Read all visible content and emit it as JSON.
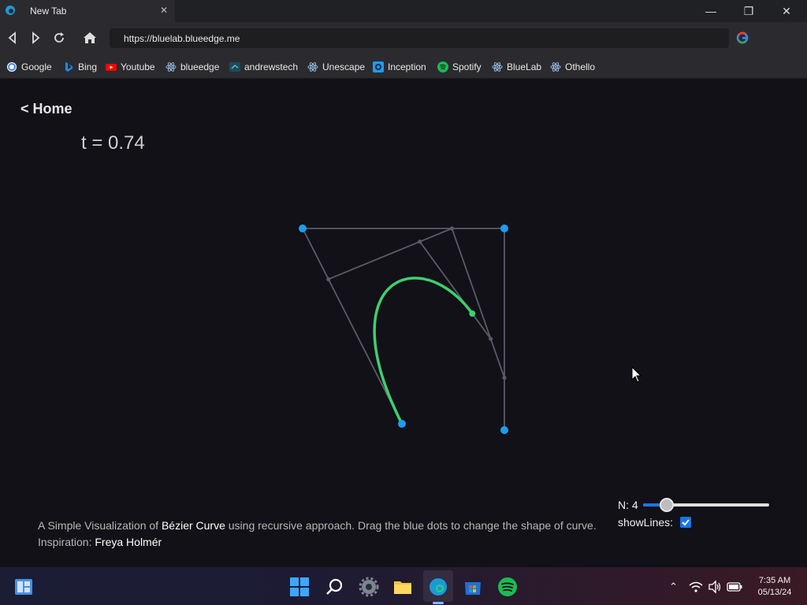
{
  "window": {
    "tab_title": "New Tab",
    "tab_close": "✕",
    "minimize": "—",
    "maximize": "❐",
    "close": "✕"
  },
  "toolbar": {
    "url": "https://bluelab.blueedge.me"
  },
  "bookmarks": [
    {
      "label": "Google",
      "icon": "google-icon",
      "color": "#4285f4"
    },
    {
      "label": "Bing",
      "icon": "bing-icon",
      "color": "#1a8cff"
    },
    {
      "label": "Youtube",
      "icon": "youtube-icon",
      "color": "#ff0000"
    },
    {
      "label": "blueedge",
      "icon": "react-icon",
      "color": "#8fb3d9"
    },
    {
      "label": "andrewstech",
      "icon": "andrewstech-icon",
      "color": "#2f6f8f"
    },
    {
      "label": "Unescape",
      "icon": "react-icon",
      "color": "#8fb3d9"
    },
    {
      "label": "Inception",
      "icon": "inception-icon",
      "color": "#1d9bf0"
    },
    {
      "label": "Spotify",
      "icon": "spotify-icon",
      "color": "#1db954"
    },
    {
      "label": "BlueLab",
      "icon": "react-icon",
      "color": "#8fb3d9"
    },
    {
      "label": "Othello",
      "icon": "react-icon",
      "color": "#8fb3d9"
    }
  ],
  "page": {
    "home_link": "< Home",
    "t_label": "t = 0.74",
    "n_label": "N: 4",
    "slider_value": 4,
    "slider_fraction": 0.19,
    "show_lines_label": "showLines:",
    "show_lines_checked": true,
    "desc_line1_a": "A Simple Visualization of ",
    "desc_line1_b": "Bézier Curve",
    "desc_line1_c": " using recursive approach. Drag the blue dots to change the shape of curve.",
    "desc_line2_a": "Inspiration: ",
    "desc_line2_b": "Freya Holmér"
  },
  "curve": {
    "t": 0.74,
    "curve_color": "#3ecf6e",
    "line_color": "#5a5a6a",
    "point_color": "#1e9bf0"
  },
  "taskbar": {
    "time": "7:35 AM",
    "date": "05/13/24"
  }
}
